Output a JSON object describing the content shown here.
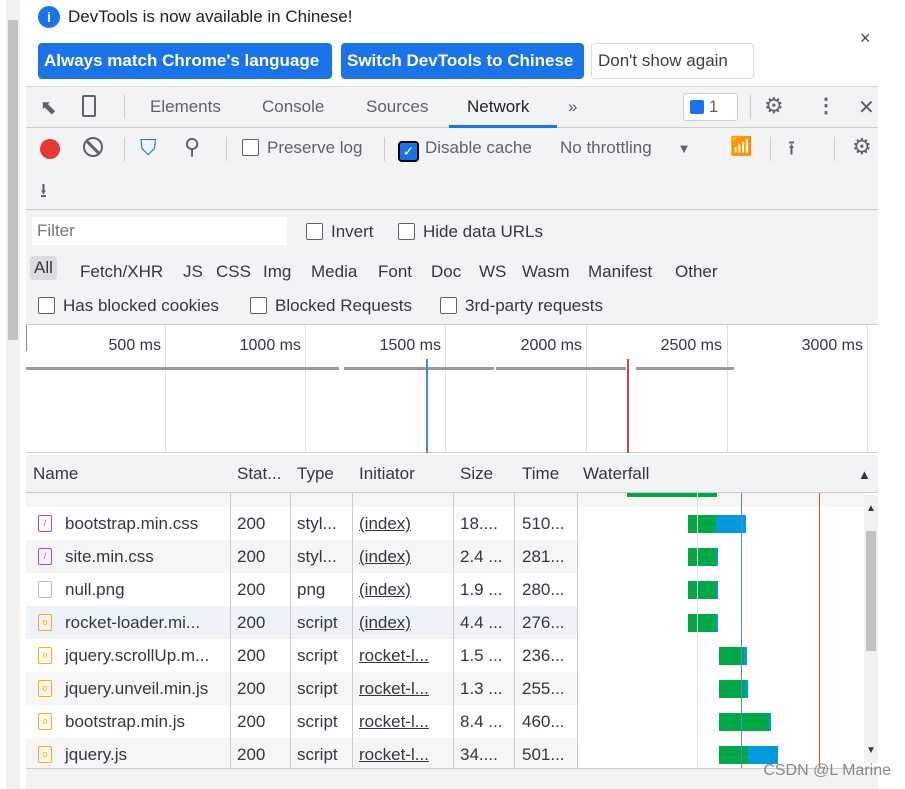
{
  "infobar": {
    "message": "DevTools is now available in Chinese!",
    "btn_match": "Always match Chrome's language",
    "btn_switch": "Switch DevTools to Chinese",
    "btn_dismiss": "Don't show again",
    "close": "×"
  },
  "tabs": [
    {
      "label": "Elements"
    },
    {
      "label": "Console"
    },
    {
      "label": "Sources"
    },
    {
      "label": "Network",
      "active": true
    }
  ],
  "more_tabs": "»",
  "issues_count": "1",
  "toolbar": {
    "preserve_log": "Preserve log",
    "preserve_log_checked": false,
    "disable_cache": "Disable cache",
    "disable_cache_checked": true,
    "throttling": "No throttling"
  },
  "filter": {
    "placeholder": "Filter",
    "invert": "Invert",
    "hide_data_urls": "Hide data URLs",
    "types": [
      "All",
      "Fetch/XHR",
      "JS",
      "CSS",
      "Img",
      "Media",
      "Font",
      "Doc",
      "WS",
      "Wasm",
      "Manifest",
      "Other"
    ],
    "has_blocked_cookies": "Has blocked cookies",
    "blocked_requests": "Blocked Requests",
    "third_party": "3rd-party requests"
  },
  "overview": {
    "ticks": [
      "500 ms",
      "1000 ms",
      "1500 ms",
      "2000 ms",
      "2500 ms",
      "3000 ms"
    ]
  },
  "columns": [
    "Name",
    "Stat...",
    "Type",
    "Initiator",
    "Size",
    "Time",
    "Waterfall"
  ],
  "rows": [
    {
      "name": "bootstrap.min.css",
      "status": "200",
      "type": "styl...",
      "initiator": "(index)",
      "size": "18....",
      "time": "510...",
      "icon": "css"
    },
    {
      "name": "site.min.css",
      "status": "200",
      "type": "styl...",
      "initiator": "(index)",
      "size": "2.4 ...",
      "time": "281...",
      "icon": "css"
    },
    {
      "name": "null.png",
      "status": "200",
      "type": "png",
      "initiator": "(index)",
      "size": "1.9 ...",
      "time": "280...",
      "icon": "image"
    },
    {
      "name": "rocket-loader.mi...",
      "status": "200",
      "type": "script",
      "initiator": "(index)",
      "size": "4.4 ...",
      "time": "276...",
      "icon": "script"
    },
    {
      "name": "jquery.scrollUp.m...",
      "status": "200",
      "type": "script",
      "initiator": "rocket-l...",
      "size": "1.5 ...",
      "time": "236...",
      "icon": "script"
    },
    {
      "name": "jquery.unveil.min.js",
      "status": "200",
      "type": "script",
      "initiator": "rocket-l...",
      "size": "1.3 ...",
      "time": "255...",
      "icon": "script"
    },
    {
      "name": "bootstrap.min.js",
      "status": "200",
      "type": "script",
      "initiator": "rocket-l...",
      "size": "8.4 ...",
      "time": "460...",
      "icon": "script"
    },
    {
      "name": "jquery.js",
      "status": "200",
      "type": "script",
      "initiator": "rocket-l...",
      "size": "34....",
      "time": "501...",
      "icon": "script"
    }
  ],
  "colors": {
    "accent": "#1a73e8",
    "waiting": "#00a846",
    "download": "#0299de",
    "dom_content_loaded": "#4a89dc",
    "load": "#d04545"
  },
  "watermark": "CSDN @L Marine"
}
